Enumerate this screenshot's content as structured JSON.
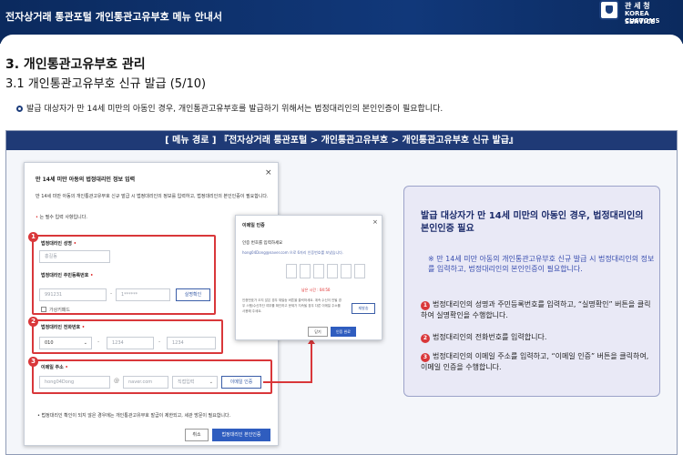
{
  "banner": {
    "title": "전자상거래 통관포털 개인통관고유부호 메뉴 안내서",
    "logo": {
      "kr": "관 세 청",
      "en_line1": "KOREA CUSTOMS",
      "en_line2": "SERVICE"
    }
  },
  "heading": {
    "h1": "3. 개인통관고유부호 관리",
    "h2": "3.1 개인통관고유부호 신규 발급 (5/10)",
    "bullet": "발급 대상자가 만 14세 미만의 아동인 경우, 개인통관고유부호를 발급하기 위해서는 법정대리인의 본인인증이 필요합니다."
  },
  "frame": {
    "path": "[ 메뉴 경로 ] 『전자상거래 통관포털 > 개인통관고유부호 > 개인통관고유부호 신규 발급』"
  },
  "modal1": {
    "title": "만 14세 미만 아동의 법정대리인 정보 입력",
    "close": "×",
    "desc": "만 14세 미만 아동의 개인통관고유부호 신규 발급 시 법정대리인의 정보를 입력하고, 법정대리인의 본인인증이 필요합니다.",
    "required_note": "는 필수 입력 사항입니다.",
    "required_star": "•",
    "name_label": "법정대리인 성명",
    "name_placeholder": "홍길동",
    "rrn_label": "법정대리인 주민등록번호",
    "rrn_front": "991231",
    "rrn_back": "1******",
    "rrn_dash": "-",
    "verify_button": "실명확인",
    "foreigner_label": "가상키패드",
    "phone_label": "법정대리인 전화번호",
    "phone_prefix": "010",
    "phone_mid": "1234",
    "phone_last": "1234",
    "email_label": "이메일 주소",
    "email_id": "hong04Dong",
    "email_at": "@",
    "email_domain": "naver.com",
    "email_select": "직접입력",
    "email_verify_button": "이메일 인증",
    "note": "• 법정대리인 확인이 되지 않은 경우에는 개인통관고유부호 발급이 제한되고, 세관 방문이 필요합니다.",
    "cancel_button": "취소",
    "confirm_button": "법정대리인 본인인증"
  },
  "modal2": {
    "title": "이메일 인증",
    "close": "×",
    "subtitle": "인증 번호를 입력하세요",
    "email_line": "hong04Dong@naver.com 으로 6자리 인증번호를 보냈습니다.",
    "timer": "남은 시간 : 04:50",
    "info": "인증번호가 오지 않은 경우 재발송 버튼을 클릭하세요. 계속 수신이 안될 경우 스팸/수신차단 여부를 확인하고 문제가 지속될 경우 다른 이메일 주소를 사용해 주세요.",
    "resend_button": "재발송",
    "close_button": "닫기",
    "confirm_button": "인증 완료"
  },
  "infobox": {
    "title": "발급 대상자가 만 14세 미만의 아동인 경우, 법정대리인의 본인인증 필요",
    "note": "※ 만 14세 미만 아동의 개인통관고유부호 신규 발급 시 법정대리인의 정보를 입력하고, 법정대리인의 본인인증이 필요합니다.",
    "items": [
      {
        "num": "1",
        "text": "법정대리인의 성명과 주민등록번호를 입력하고, “실명확인” 버튼을 클릭하여 실명확인을 수행합니다."
      },
      {
        "num": "2",
        "text": "법정대리인의 전화번호를 입력합니다."
      },
      {
        "num": "3",
        "text": "법정대리인의 이메일 주소를 입력하고, “이메일 인증” 버튼을 클릭하여, 이메일 인증을 수행합니다."
      }
    ]
  },
  "badges": [
    "1",
    "2",
    "3"
  ],
  "colors": {
    "banner": "#0b2a5e",
    "frame_head": "#1f3a76",
    "highlight": "#d9373a",
    "accent": "#2f5dbf"
  }
}
